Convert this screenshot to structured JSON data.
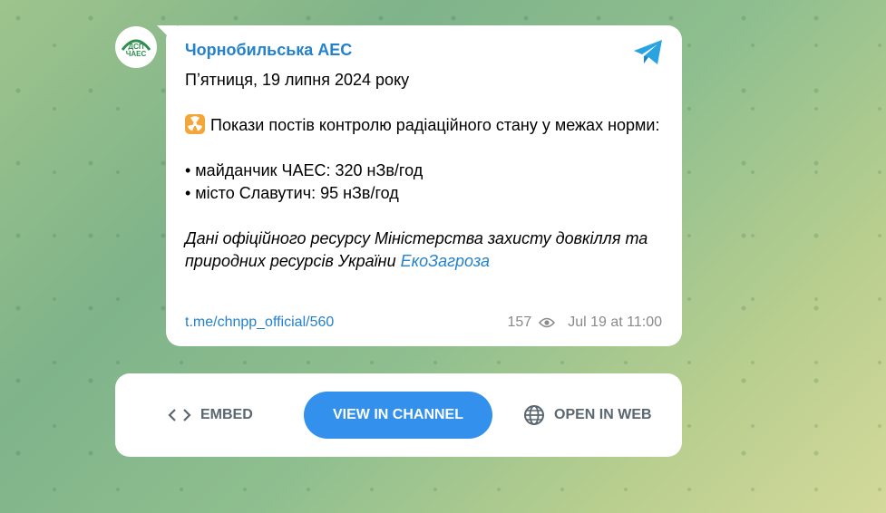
{
  "channel": {
    "name": "Чорнобильська АЕС",
    "avatar_text": "ДСП ЧАЕС"
  },
  "message": {
    "date_line": "Пʼятниця, 19 липня 2024 року",
    "intro": "Покази постів контролю радіаційного стану у межах норми:",
    "bullet1_label": "• майданчик ЧАЕС: ",
    "bullet1_value": "320 нЗв/год",
    "bullet2_label": "• місто Славутич: ",
    "bullet2_value": "95 нЗв/год",
    "source_text": "Дані офіційного ресурсу Міністерства захисту довкілля та природних ресурсів України ",
    "source_link": "ЕкоЗагроза"
  },
  "meta": {
    "post_link": "t.me/chnpp_official/560",
    "views": "157",
    "timestamp": "Jul 19 at 11:00"
  },
  "actions": {
    "embed": "EMBED",
    "view_in_channel": "VIEW IN CHANNEL",
    "open_in_web": "OPEN IN WEB"
  },
  "colors": {
    "accent": "#2481cc",
    "button": "#3390ec",
    "radio_bg": "#f3a73a"
  },
  "icons": [
    "telegram-icon",
    "radioactive-icon",
    "eye-icon",
    "code-icon",
    "globe-icon"
  ]
}
